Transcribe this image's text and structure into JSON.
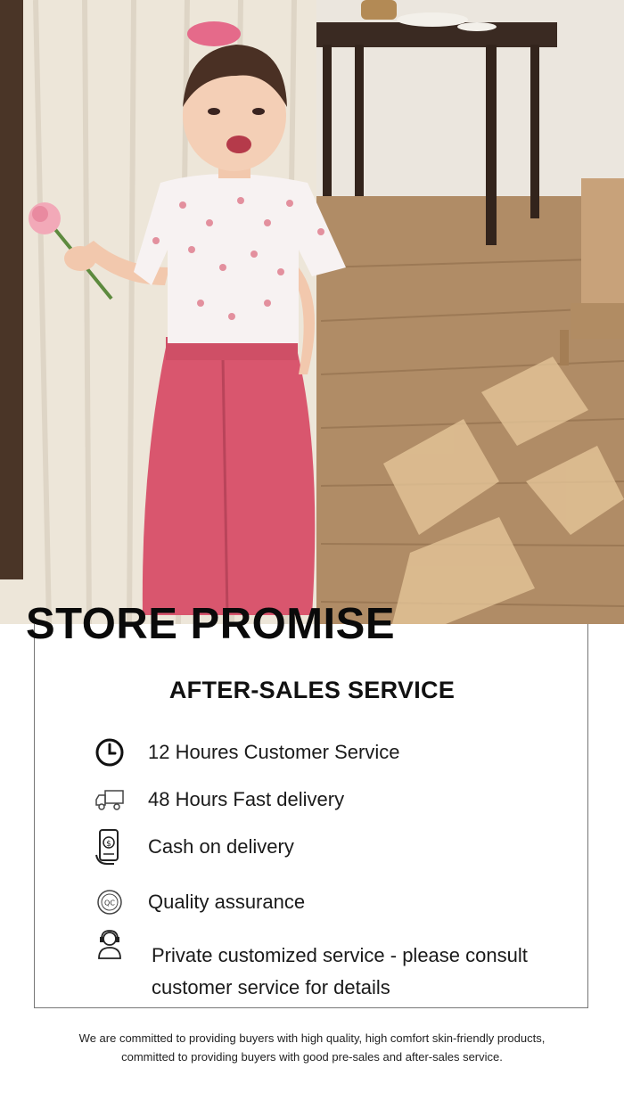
{
  "banner": {
    "title": "STORE PROMISE",
    "colors": {
      "pants": "#d9566e",
      "curtain": "#ece6da",
      "floor": "#b5916b",
      "wall": "#ebe7e0"
    }
  },
  "service": {
    "heading": "AFTER-SALES SERVICE",
    "items": [
      {
        "icon": "clock-icon",
        "label": "12 Houres Customer Service"
      },
      {
        "icon": "delivery-truck-icon",
        "label": "48 Hours Fast delivery"
      },
      {
        "icon": "phone-payment-icon",
        "label": "Cash on delivery"
      },
      {
        "icon": "qc-badge-icon",
        "label": "Quality assurance"
      },
      {
        "icon": "headset-agent-icon",
        "label": "Private customized service - please consult customer service for details"
      }
    ]
  },
  "footer": {
    "line1": "We are committed to providing buyers with high quality, high comfort skin-friendly products,",
    "line2": "committed to providing buyers with good pre-sales and after-sales service."
  }
}
